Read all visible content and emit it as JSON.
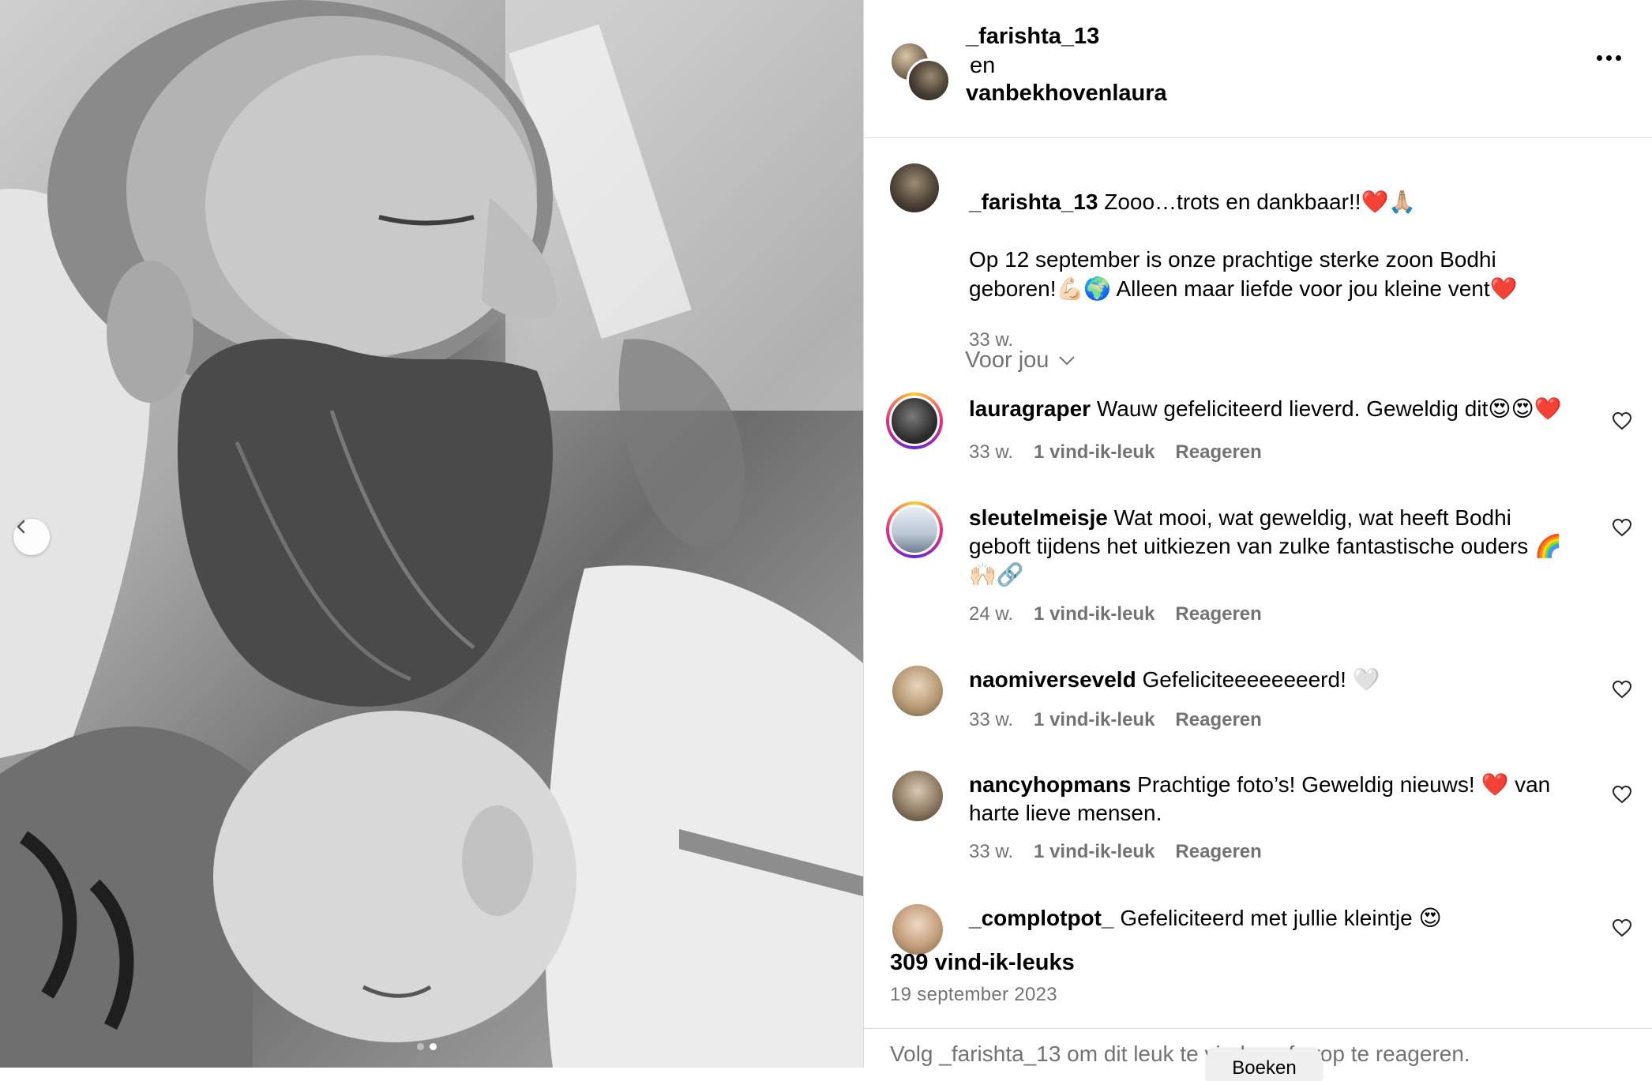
{
  "post": {
    "authors": {
      "primary": "_farishta_13",
      "conjunction": "en",
      "secondary": "vanbekhovenlaura"
    },
    "caption": {
      "user": "_farishta_13",
      "line1": "Zooo…trots en dankbaar!!❤️🙏🏼",
      "line2": "Op 12 september is onze prachtige sterke zoon Bodhi geboren!💪🏻🌍 Alleen maar liefde voor jou kleine vent❤️",
      "time": "33 w."
    },
    "sort_label": "Voor jou",
    "comments": [
      {
        "user": "lauragraper",
        "text": "Wauw gefeliciteerd lieverd. Geweldig dit😍😍❤️",
        "time": "33 w.",
        "likes": "1 vind-ik-leuk",
        "reply": "Reageren"
      },
      {
        "user": "sleutelmeisje",
        "text": "Wat mooi, wat geweldig, wat heeft Bodhi geboft tijdens het uitkiezen van zulke fantastische ouders 🌈🙌🏻🔗",
        "time": "24 w.",
        "likes": "1 vind-ik-leuk",
        "reply": "Reageren"
      },
      {
        "user": "naomiverseveld",
        "text": "Gefeliciteeeeeeeerd! 🤍",
        "time": "33 w.",
        "likes": "1 vind-ik-leuk",
        "reply": "Reageren"
      },
      {
        "user": "nancyhopmans",
        "text": "Prachtige foto’s! Geweldig nieuws! ❤️ van harte lieve mensen.",
        "time": "33 w.",
        "likes": "1 vind-ik-leuk",
        "reply": "Reageren"
      },
      {
        "user": "_complotpot_",
        "text": "Gefeliciteerd met jullie kleintje 😍"
      }
    ],
    "like_count": "309 vind-ik-leuks",
    "date": "19 september 2023",
    "footer_text": "Volg _farishta_13 om dit leuk te vinden of erop te reageren.",
    "popup_label": "Boeken"
  },
  "icons": {
    "more": "more-horizontal-icon",
    "heart": "heart-outline-icon",
    "prev": "chevron-left-icon",
    "chevron": "chevron-down-icon"
  },
  "colors": {
    "secondary_text": "#737373",
    "divider": "#dbdbdb",
    "heart_emoji": "#ed4956"
  }
}
